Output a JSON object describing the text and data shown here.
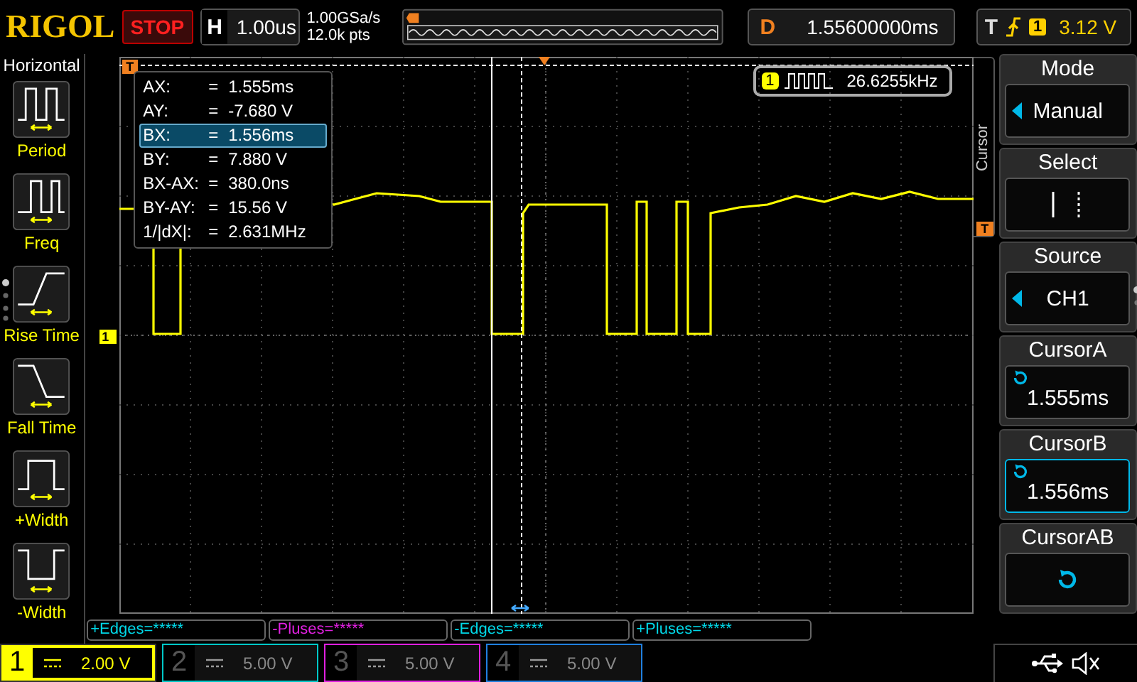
{
  "brand": "RIGOL",
  "run_state": "STOP",
  "timebase": {
    "label": "H",
    "value": "1.00us"
  },
  "acquisition": {
    "sample_rate": "1.00GSa/s",
    "memory_depth": "12.0k pts"
  },
  "delay": {
    "label": "D",
    "value": "1.55600000ms"
  },
  "trigger": {
    "label": "T",
    "channel": "1",
    "level": "3.12 V"
  },
  "left_menu": {
    "title": "Horizontal",
    "items": [
      {
        "label": "Period",
        "kind": "period"
      },
      {
        "label": "Freq",
        "kind": "freq"
      },
      {
        "label": "Rise Time",
        "kind": "rise"
      },
      {
        "label": "Fall Time",
        "kind": "fall"
      },
      {
        "label": "+Width",
        "kind": "pwidth"
      },
      {
        "label": "-Width",
        "kind": "nwidth"
      }
    ]
  },
  "grid": {
    "trigger_position_marker": "T",
    "trigger_level_marker": "T",
    "channel_marker": "1"
  },
  "cursor_readout": [
    {
      "name": "AX:",
      "sign": "=",
      "value": "1.555ms",
      "selected": false
    },
    {
      "name": "AY:",
      "sign": "=",
      "value": "-7.680 V",
      "selected": false
    },
    {
      "name": "BX:",
      "sign": "=",
      "value": "1.556ms",
      "selected": true
    },
    {
      "name": "BY:",
      "sign": "=",
      "value": "7.880 V",
      "selected": false
    },
    {
      "name": "BX-AX:",
      "sign": "=",
      "value": "380.0ns",
      "selected": false
    },
    {
      "name": "BY-AY:",
      "sign": "=",
      "value": "15.56 V",
      "selected": false
    },
    {
      "name": "1/|dX|:",
      "sign": "=",
      "value": "2.631MHz",
      "selected": false
    }
  ],
  "frequency_counter": {
    "channel": "1",
    "value": "26.6255kHz"
  },
  "right_menu": {
    "title": "Cursor",
    "items": [
      {
        "label": "Mode",
        "kind": "option",
        "value": "Manual",
        "selected": false
      },
      {
        "label": "Select",
        "kind": "cursor_select",
        "selected": false
      },
      {
        "label": "Source",
        "kind": "option",
        "value": "CH1",
        "selected": false
      },
      {
        "label": "CursorA",
        "kind": "knob",
        "value": "1.555ms",
        "selected": false
      },
      {
        "label": "CursorB",
        "kind": "knob",
        "value": "1.556ms",
        "selected": true
      },
      {
        "label": "CursorAB",
        "kind": "knob",
        "selected": false
      }
    ]
  },
  "measurements": [
    {
      "text": "+Edges=*****",
      "color": "#00d8e8"
    },
    {
      "text": "-Pluses=*****",
      "color": "#e020e0"
    },
    {
      "text": "-Edges=*****",
      "color": "#00d8e8"
    },
    {
      "text": "+Pluses=*****",
      "color": "#00d8e8"
    }
  ],
  "channels": [
    {
      "number": "1",
      "scale": "2.00 V",
      "on": true,
      "color": "#ffff00"
    },
    {
      "number": "2",
      "scale": "5.00 V",
      "on": false,
      "color": "#00c8c8"
    },
    {
      "number": "3",
      "scale": "5.00 V",
      "on": false,
      "color": "#e020e0"
    },
    {
      "number": "4",
      "scale": "5.00 V",
      "on": false,
      "color": "#2080e0"
    }
  ]
}
